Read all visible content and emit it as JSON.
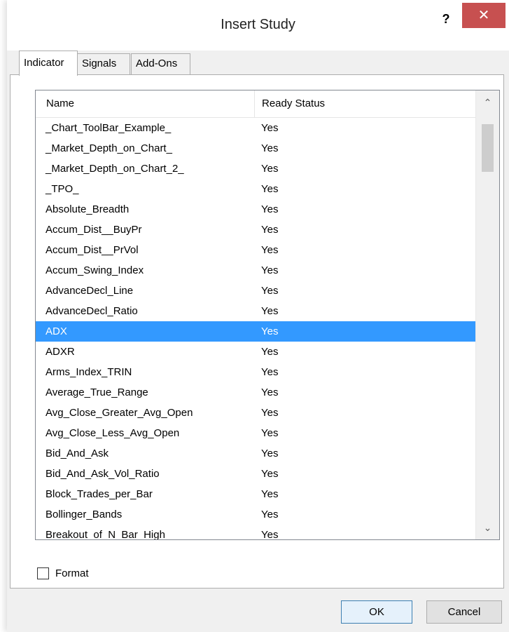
{
  "window": {
    "title": "Insert Study",
    "help_label": "?",
    "close_label": "✕"
  },
  "tabs": [
    {
      "label": "Indicator",
      "active": true
    },
    {
      "label": "Signals",
      "active": false
    },
    {
      "label": "Add-Ons",
      "active": false
    }
  ],
  "list": {
    "columns": [
      "Name",
      "Ready Status"
    ],
    "selected_row": "ADX",
    "rows": [
      {
        "name": "_Chart_ToolBar_Example_",
        "status": "Yes"
      },
      {
        "name": "_Market_Depth_on_Chart_",
        "status": "Yes"
      },
      {
        "name": "_Market_Depth_on_Chart_2_",
        "status": "Yes"
      },
      {
        "name": "_TPO_",
        "status": "Yes"
      },
      {
        "name": "Absolute_Breadth",
        "status": "Yes"
      },
      {
        "name": "Accum_Dist__BuyPr",
        "status": "Yes"
      },
      {
        "name": "Accum_Dist__PrVol",
        "status": "Yes"
      },
      {
        "name": "Accum_Swing_Index",
        "status": "Yes"
      },
      {
        "name": "AdvanceDecl_Line",
        "status": "Yes"
      },
      {
        "name": "AdvanceDecl_Ratio",
        "status": "Yes"
      },
      {
        "name": "ADX",
        "status": "Yes"
      },
      {
        "name": "ADXR",
        "status": "Yes"
      },
      {
        "name": "Arms_Index_TRIN",
        "status": "Yes"
      },
      {
        "name": "Average_True_Range",
        "status": "Yes"
      },
      {
        "name": "Avg_Close_Greater_Avg_Open",
        "status": "Yes"
      },
      {
        "name": "Avg_Close_Less_Avg_Open",
        "status": "Yes"
      },
      {
        "name": "Bid_And_Ask",
        "status": "Yes"
      },
      {
        "name": "Bid_And_Ask_Vol_Ratio",
        "status": "Yes"
      },
      {
        "name": "Block_Trades_per_Bar",
        "status": "Yes"
      },
      {
        "name": "Bollinger_Bands",
        "status": "Yes"
      },
      {
        "name": "Breakout_of_N_Bar_High",
        "status": "Yes"
      }
    ],
    "scroll_up_icon": "chevron-up-icon",
    "scroll_down_icon": "chevron-down-icon"
  },
  "format": {
    "label": "Format",
    "checked": false
  },
  "buttons": {
    "ok": "OK",
    "cancel": "Cancel"
  }
}
